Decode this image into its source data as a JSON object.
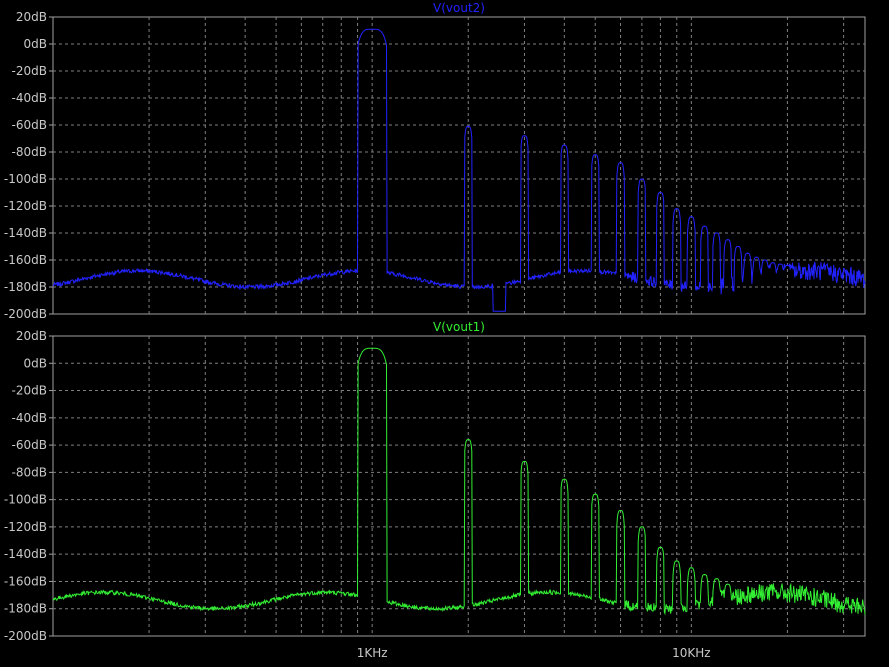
{
  "chart_data": [
    {
      "type": "line",
      "title": "V(vout2)",
      "trace_color": "#2222ff",
      "x_scale": "log",
      "xlim": [
        100,
        35000
      ],
      "x_tick_labels": [
        "",
        ""
      ],
      "ylim": [
        -200,
        20
      ],
      "y_tick_labels": [
        "20dB",
        "0dB",
        "-20dB",
        "-40dB",
        "-60dB",
        "-80dB",
        "-100dB",
        "-120dB",
        "-140dB",
        "-160dB",
        "-180dB",
        "-200dB"
      ],
      "noise_floor_db": -172,
      "harmonics": [
        {
          "freq_hz": 1000,
          "level_db": 11
        },
        {
          "freq_hz": 2000,
          "level_db": -61
        },
        {
          "freq_hz": 3000,
          "level_db": -68
        },
        {
          "freq_hz": 4000,
          "level_db": -75
        },
        {
          "freq_hz": 5000,
          "level_db": -82
        },
        {
          "freq_hz": 6000,
          "level_db": -88
        },
        {
          "freq_hz": 7000,
          "level_db": -100
        },
        {
          "freq_hz": 8000,
          "level_db": -110
        },
        {
          "freq_hz": 9000,
          "level_db": -122
        },
        {
          "freq_hz": 10000,
          "level_db": -128
        },
        {
          "freq_hz": 11000,
          "level_db": -135
        },
        {
          "freq_hz": 12000,
          "level_db": -140
        },
        {
          "freq_hz": 13000,
          "level_db": -145
        },
        {
          "freq_hz": 14000,
          "level_db": -150
        },
        {
          "freq_hz": 15000,
          "level_db": -155
        },
        {
          "freq_hz": 16000,
          "level_db": -158
        },
        {
          "freq_hz": 17000,
          "level_db": -160
        },
        {
          "freq_hz": 18000,
          "level_db": -162
        },
        {
          "freq_hz": 19000,
          "level_db": -163
        },
        {
          "freq_hz": 20000,
          "level_db": -164
        }
      ]
    },
    {
      "type": "line",
      "title": "V(vout1)",
      "trace_color": "#33ee33",
      "x_scale": "log",
      "xlim": [
        100,
        35000
      ],
      "x_tick_labels": [
        "1KHz",
        "10KHz"
      ],
      "ylim": [
        -200,
        20
      ],
      "y_tick_labels": [
        "20dB",
        "0dB",
        "-20dB",
        "-40dB",
        "-60dB",
        "-80dB",
        "-100dB",
        "-120dB",
        "-140dB",
        "-160dB",
        "-180dB",
        "-200dB"
      ],
      "noise_floor_db": -172,
      "harmonics": [
        {
          "freq_hz": 1000,
          "level_db": 11
        },
        {
          "freq_hz": 2000,
          "level_db": -56
        },
        {
          "freq_hz": 3000,
          "level_db": -72
        },
        {
          "freq_hz": 4000,
          "level_db": -85
        },
        {
          "freq_hz": 5000,
          "level_db": -96
        },
        {
          "freq_hz": 6000,
          "level_db": -108
        },
        {
          "freq_hz": 7000,
          "level_db": -120
        },
        {
          "freq_hz": 8000,
          "level_db": -135
        },
        {
          "freq_hz": 9000,
          "level_db": -145
        },
        {
          "freq_hz": 10000,
          "level_db": -150
        },
        {
          "freq_hz": 11000,
          "level_db": -155
        },
        {
          "freq_hz": 12000,
          "level_db": -158
        },
        {
          "freq_hz": 13000,
          "level_db": -162
        }
      ]
    }
  ]
}
